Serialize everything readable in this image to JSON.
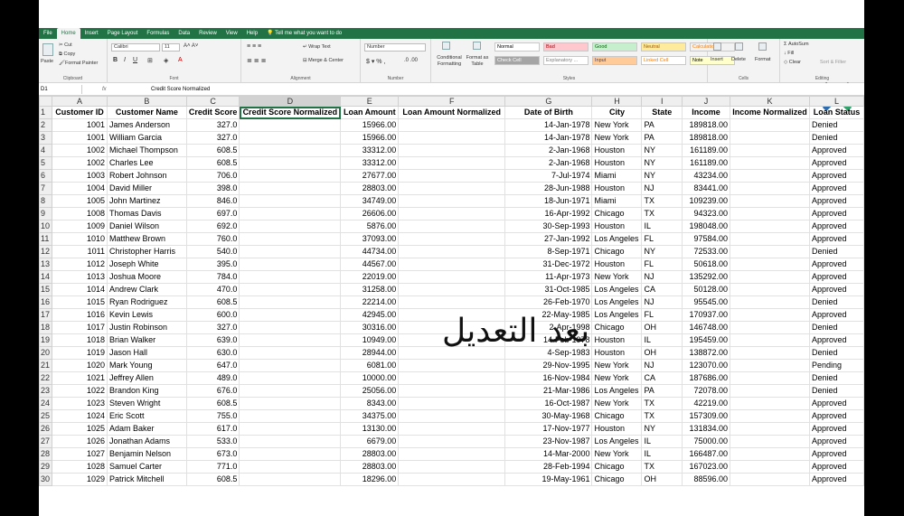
{
  "ribbon": {
    "tabs": [
      "File",
      "Home",
      "Insert",
      "Page Layout",
      "Formulas",
      "Data",
      "Review",
      "View",
      "Help"
    ],
    "active_tab": "Home",
    "tell_me": "Tell me what you want to do",
    "clipboard": {
      "label": "Clipboard",
      "paste": "Paste",
      "cut": "Cut",
      "copy": "Copy",
      "format_painter": "Format Painter"
    },
    "font": {
      "label": "Font",
      "name": "Calibri",
      "size": "11"
    },
    "alignment": {
      "label": "Alignment",
      "wrap": "Wrap Text",
      "merge": "Merge & Center"
    },
    "number": {
      "label": "Number",
      "format": "Number"
    },
    "styles": {
      "label": "Styles",
      "conditional": "Conditional Formatting",
      "format_table": "Format as Table",
      "cells": [
        {
          "text": "Normal",
          "bg": "#ffffff",
          "color": "#000000"
        },
        {
          "text": "Bad",
          "bg": "#ffc7ce",
          "color": "#9c0006"
        },
        {
          "text": "Good",
          "bg": "#c6efce",
          "color": "#006100"
        },
        {
          "text": "Neutral",
          "bg": "#ffeb9c",
          "color": "#9c5700"
        },
        {
          "text": "Calculation",
          "bg": "#f2f2f2",
          "color": "#fa7d00"
        },
        {
          "text": "Check Cell",
          "bg": "#a5a5a5",
          "color": "#ffffff"
        },
        {
          "text": "Explanatory ...",
          "bg": "#ffffff",
          "color": "#7f7f7f"
        },
        {
          "text": "Input",
          "bg": "#ffcc99",
          "color": "#3f3f76"
        },
        {
          "text": "Linked Cell",
          "bg": "#ffffff",
          "color": "#fa7d00"
        },
        {
          "text": "Note",
          "bg": "#ffffcc",
          "color": "#000000"
        }
      ]
    },
    "cells": {
      "label": "Cells",
      "insert": "Insert",
      "delete": "Delete",
      "format": "Format"
    },
    "editing": {
      "label": "Editing",
      "autosum": "AutoSum",
      "fill": "Fill",
      "clear": "Clear",
      "sort": "Sort & Filter"
    }
  },
  "formula_bar": {
    "name_box": "D1",
    "fx": "fx",
    "content": "Credit Score Normalized"
  },
  "columns": [
    "A",
    "B",
    "C",
    "D",
    "E",
    "F",
    "G",
    "H",
    "I",
    "J",
    "K",
    "L"
  ],
  "headers": [
    "Customer ID",
    "Customer Name",
    "Credit Score",
    "Credit Score Normalized",
    "Loan Amount",
    "Loan Amount Normalized",
    "Date of Birth",
    "City",
    "State",
    "Income",
    "Income Normalized",
    "Loan Status"
  ],
  "rows": [
    [
      "1001",
      "James Anderson",
      "327.0",
      "",
      "15966.00",
      "",
      "14-Jan-1978",
      "New York",
      "PA",
      "189818.00",
      "",
      "Denied"
    ],
    [
      "1001",
      "William Garcia",
      "327.0",
      "",
      "15966.00",
      "",
      "14-Jan-1978",
      "New York",
      "PA",
      "189818.00",
      "",
      "Denied"
    ],
    [
      "1002",
      "Michael Thompson",
      "608.5",
      "",
      "33312.00",
      "",
      "2-Jan-1968",
      "Houston",
      "NY",
      "161189.00",
      "",
      "Approved"
    ],
    [
      "1002",
      "Charles Lee",
      "608.5",
      "",
      "33312.00",
      "",
      "2-Jan-1968",
      "Houston",
      "NY",
      "161189.00",
      "",
      "Approved"
    ],
    [
      "1003",
      "Robert Johnson",
      "706.0",
      "",
      "27677.00",
      "",
      "7-Jul-1974",
      "Miami",
      "NY",
      "43234.00",
      "",
      "Approved"
    ],
    [
      "1004",
      "David Miller",
      "398.0",
      "",
      "28803.00",
      "",
      "28-Jun-1988",
      "Houston",
      "NJ",
      "83441.00",
      "",
      "Approved"
    ],
    [
      "1005",
      "John Martinez",
      "846.0",
      "",
      "34749.00",
      "",
      "18-Jun-1971",
      "Miami",
      "TX",
      "109239.00",
      "",
      "Approved"
    ],
    [
      "1008",
      "Thomas Davis",
      "697.0",
      "",
      "26606.00",
      "",
      "16-Apr-1992",
      "Chicago",
      "TX",
      "94323.00",
      "",
      "Approved"
    ],
    [
      "1009",
      "Daniel Wilson",
      "692.0",
      "",
      "5876.00",
      "",
      "30-Sep-1993",
      "Houston",
      "IL",
      "198048.00",
      "",
      "Approved"
    ],
    [
      "1010",
      "Matthew Brown",
      "760.0",
      "",
      "37093.00",
      "",
      "27-Jan-1992",
      "Los Angeles",
      "FL",
      "97584.00",
      "",
      "Approved"
    ],
    [
      "1011",
      "Christopher Harris",
      "540.0",
      "",
      "44734.00",
      "",
      "8-Sep-1971",
      "Chicago",
      "NY",
      "72533.00",
      "",
      "Denied"
    ],
    [
      "1012",
      "Joseph White",
      "395.0",
      "",
      "44567.00",
      "",
      "31-Dec-1972",
      "Houston",
      "FL",
      "50618.00",
      "",
      "Approved"
    ],
    [
      "1013",
      "Joshua Moore",
      "784.0",
      "",
      "22019.00",
      "",
      "11-Apr-1973",
      "New York",
      "NJ",
      "135292.00",
      "",
      "Approved"
    ],
    [
      "1014",
      "Andrew Clark",
      "470.0",
      "",
      "31258.00",
      "",
      "31-Oct-1985",
      "Los Angeles",
      "CA",
      "50128.00",
      "",
      "Approved"
    ],
    [
      "1015",
      "Ryan Rodriguez",
      "608.5",
      "",
      "22214.00",
      "",
      "26-Feb-1970",
      "Los Angeles",
      "NJ",
      "95545.00",
      "",
      "Denied"
    ],
    [
      "1016",
      "Kevin Lewis",
      "600.0",
      "",
      "42945.00",
      "",
      "22-May-1985",
      "Los Angeles",
      "FL",
      "170937.00",
      "",
      "Approved"
    ],
    [
      "1017",
      "Justin Robinson",
      "327.0",
      "",
      "30316.00",
      "",
      "2-Apr-1998",
      "Chicago",
      "OH",
      "146748.00",
      "",
      "Denied"
    ],
    [
      "1018",
      "Brian Walker",
      "639.0",
      "",
      "10949.00",
      "",
      "14-Feb-1978",
      "Houston",
      "IL",
      "195459.00",
      "",
      "Approved"
    ],
    [
      "1019",
      "Jason Hall",
      "630.0",
      "",
      "28944.00",
      "",
      "4-Sep-1983",
      "Houston",
      "OH",
      "138872.00",
      "",
      "Denied"
    ],
    [
      "1020",
      "Mark Young",
      "647.0",
      "",
      "6081.00",
      "",
      "29-Nov-1995",
      "New York",
      "NJ",
      "123070.00",
      "",
      "Pending"
    ],
    [
      "1021",
      "Jeffrey Allen",
      "489.0",
      "",
      "10000.00",
      "",
      "16-Nov-1984",
      "New York",
      "CA",
      "187686.00",
      "",
      "Denied"
    ],
    [
      "1022",
      "Brandon King",
      "676.0",
      "",
      "25056.00",
      "",
      "21-Mar-1986",
      "Los Angeles",
      "PA",
      "72078.00",
      "",
      "Denied"
    ],
    [
      "1023",
      "Steven Wright",
      "608.5",
      "",
      "8343.00",
      "",
      "16-Oct-1987",
      "New York",
      "TX",
      "42219.00",
      "",
      "Approved"
    ],
    [
      "1024",
      "Eric Scott",
      "755.0",
      "",
      "34375.00",
      "",
      "30-May-1968",
      "Chicago",
      "TX",
      "157309.00",
      "",
      "Approved"
    ],
    [
      "1025",
      "Adam Baker",
      "617.0",
      "",
      "13130.00",
      "",
      "17-Nov-1977",
      "Houston",
      "NY",
      "131834.00",
      "",
      "Approved"
    ],
    [
      "1026",
      "Jonathan Adams",
      "533.0",
      "",
      "6679.00",
      "",
      "23-Nov-1987",
      "Los Angeles",
      "IL",
      "75000.00",
      "",
      "Approved"
    ],
    [
      "1027",
      "Benjamin Nelson",
      "673.0",
      "",
      "28803.00",
      "",
      "14-Mar-2000",
      "New York",
      "IL",
      "166487.00",
      "",
      "Approved"
    ],
    [
      "1028",
      "Samuel Carter",
      "771.0",
      "",
      "28803.00",
      "",
      "28-Feb-1994",
      "Chicago",
      "TX",
      "167023.00",
      "",
      "Approved"
    ],
    [
      "1029",
      "Patrick Mitchell",
      "608.5",
      "",
      "18296.00",
      "",
      "19-May-1961",
      "Chicago",
      "OH",
      "88596.00",
      "",
      "Approved"
    ]
  ],
  "overlay_text": "بعد التعديل",
  "colors": {
    "excel_green": "#217346",
    "logo_blue": "#2b6cb0",
    "logo_green": "#2fa36b"
  }
}
